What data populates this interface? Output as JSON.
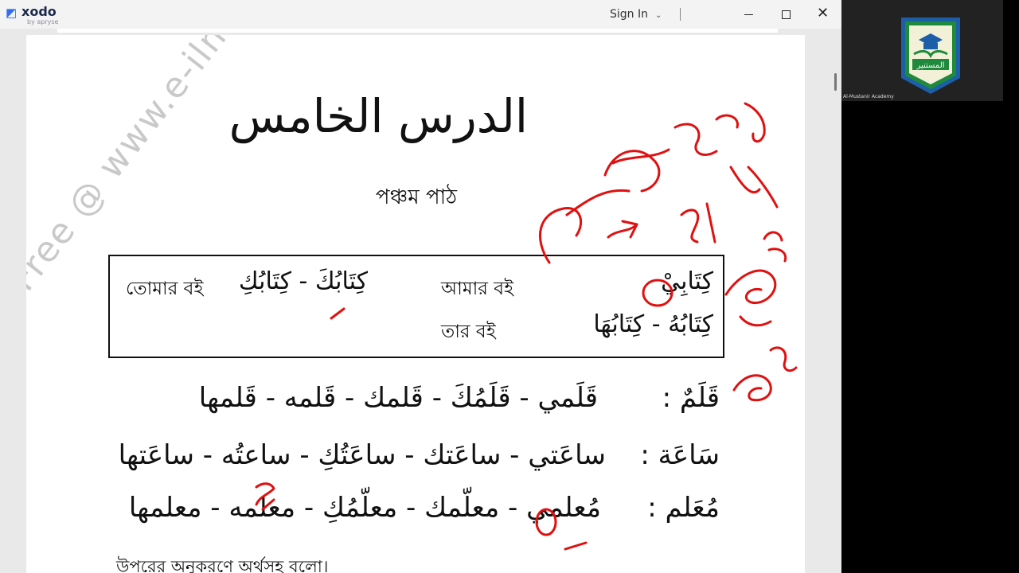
{
  "app": {
    "logo_name": "xodo",
    "logo_sub": "by apryse",
    "signin_label": "Sign In"
  },
  "document": {
    "watermark": "Free @ www.e-ilm.weebly.com",
    "lesson_title_arabic": "الدرس الخامس",
    "lesson_title_bengali": "পঞ্চম পাঠ",
    "vocab_box": {
      "row1_right_ar": "كِتَابِيْ",
      "row1_right_bn": "আমার বই",
      "row1_left_ar": "كِتَابُكَ - كِتَابُكِ",
      "row1_left_bn": "তোমার বই",
      "row2_ar": "كِتَابُهُ - كِتَابُهَا",
      "row2_bn": "তার বই"
    },
    "lines": [
      {
        "head": "قَلَمٌ :",
        "forms": "قَلَمي - قَلَمُكَ - قَلمك - قَلمه - قَلمها"
      },
      {
        "head": "سَاعَة :",
        "forms": "ساعَتي - ساعَتك - ساعَتُكِ - ساعتُه - ساعَتها"
      },
      {
        "head": "مُعَلم :",
        "forms": "مُعلمي - معلّمك - معلّمُكِ - معلمه - معلمها"
      }
    ],
    "footer_bn": "উপরের অনুকরণে অর্থসহ বলো।"
  },
  "sidebar": {
    "participant_name": "Al-Mustanir Academy",
    "badge_text": "المستنير"
  },
  "colors": {
    "pen": "#e01010",
    "badge_green": "#1f8a3b",
    "badge_blue": "#1c5fa8"
  }
}
